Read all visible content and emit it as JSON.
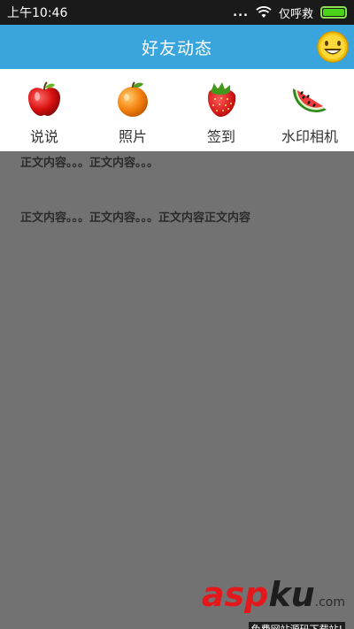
{
  "status_bar": {
    "time": "上午10:46",
    "signal_dots": "...",
    "carrier": "仅呼救"
  },
  "header": {
    "title": "好友动态"
  },
  "tabs": [
    {
      "label": "说说",
      "icon": "apple-icon"
    },
    {
      "label": "照片",
      "icon": "orange-icon"
    },
    {
      "label": "签到",
      "icon": "strawberry-icon"
    },
    {
      "label": "水印相机",
      "icon": "watermelon-icon"
    }
  ],
  "content": {
    "posts": [
      "正文内容。。。正文内容。。。",
      "正文内容。。。正文内容。。。正文内容正文内容"
    ]
  },
  "watermark": {
    "logo_red": "asp",
    "logo_dark": "ku",
    "logo_suffix": ".com",
    "slogan": "免费网站源码下载站!"
  },
  "colors": {
    "header_bg": "#3aa4dd",
    "content_bg": "#727272",
    "battery": "#4bd31a"
  }
}
